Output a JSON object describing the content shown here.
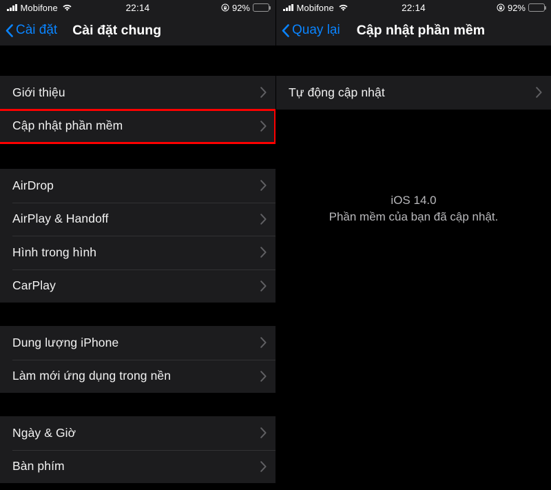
{
  "left": {
    "status_bar": {
      "carrier": "Mobifone",
      "time": "22:14",
      "battery_percent": "92%",
      "signal_icon": "cellular-signal-icon",
      "wifi_icon": "wifi-icon",
      "lock_icon": "rotation-lock-icon",
      "battery_icon": "battery-icon"
    },
    "nav": {
      "back_label": "Cài đặt",
      "back_icon": "chevron-left-icon",
      "title": "Cài đặt chung"
    },
    "sections": [
      {
        "items": [
          {
            "label": "Giới thiệu",
            "chevron": "chevron-right-icon",
            "highlighted": false
          },
          {
            "label": "Cập nhật phần mềm",
            "chevron": "chevron-right-icon",
            "highlighted": true
          }
        ]
      },
      {
        "items": [
          {
            "label": "AirDrop",
            "chevron": "chevron-right-icon",
            "highlighted": false
          },
          {
            "label": "AirPlay & Handoff",
            "chevron": "chevron-right-icon",
            "highlighted": false
          },
          {
            "label": "Hình trong hình",
            "chevron": "chevron-right-icon",
            "highlighted": false
          },
          {
            "label": "CarPlay",
            "chevron": "chevron-right-icon",
            "highlighted": false
          }
        ]
      },
      {
        "items": [
          {
            "label": "Dung lượng iPhone",
            "chevron": "chevron-right-icon",
            "highlighted": false
          },
          {
            "label": "Làm mới ứng dụng trong nền",
            "chevron": "chevron-right-icon",
            "highlighted": false
          }
        ]
      },
      {
        "items": [
          {
            "label": "Ngày & Giờ",
            "chevron": "chevron-right-icon",
            "highlighted": false
          },
          {
            "label": "Bàn phím",
            "chevron": "chevron-right-icon",
            "highlighted": false
          }
        ]
      }
    ]
  },
  "right": {
    "status_bar": {
      "carrier": "Mobifone",
      "time": "22:14",
      "battery_percent": "92%",
      "signal_icon": "cellular-signal-icon",
      "wifi_icon": "wifi-icon",
      "lock_icon": "rotation-lock-icon",
      "battery_icon": "battery-icon"
    },
    "nav": {
      "back_label": "Quay lại",
      "back_icon": "chevron-left-icon",
      "title": "Cập nhật phần mềm"
    },
    "sections": [
      {
        "items": [
          {
            "label": "Tự động cập nhật",
            "chevron": "chevron-right-icon",
            "highlighted": false
          }
        ]
      }
    ],
    "update_status": {
      "version": "iOS 14.0",
      "message": "Phần mềm của bạn đã cập nhật."
    }
  },
  "colors": {
    "background": "#000000",
    "group_background": "#1c1c1e",
    "accent_blue": "#0a84ff",
    "highlight_red": "#ff0000",
    "separator": "#323234",
    "primary_text": "#f2f2f2",
    "secondary_text": "#b9b9bc"
  }
}
